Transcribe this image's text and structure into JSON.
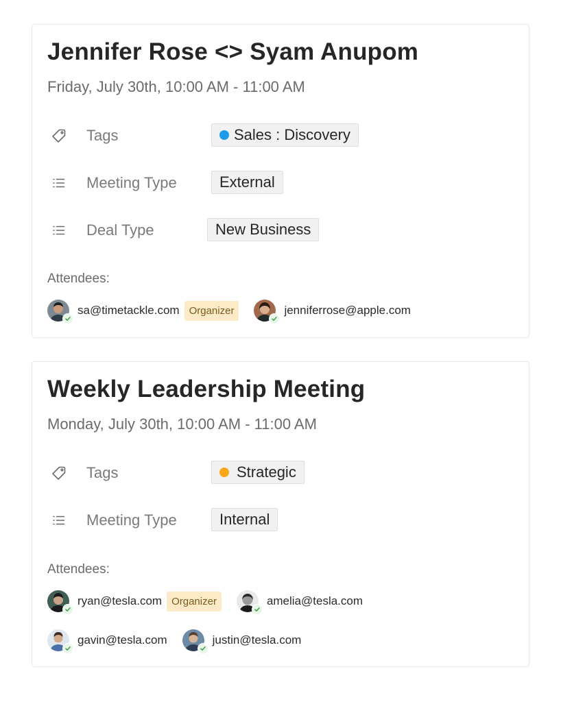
{
  "meetings": [
    {
      "title": "Jennifer Rose <> Syam Anupom",
      "date": "Friday, July 30th, 10:00 AM - 11:00 AM",
      "properties": [
        {
          "icon": "tag-icon",
          "label": "Tags",
          "value": "Sales : Discovery",
          "dot_color": "#1e9be9"
        },
        {
          "icon": "list-icon",
          "label": "Meeting Type",
          "value": "External"
        },
        {
          "icon": "list-icon",
          "label": "Deal Type",
          "value": "New Business"
        }
      ],
      "attendees_label": "Attendees:",
      "attendees": [
        {
          "email": "sa@timetackle.com",
          "role": "Organizer",
          "avatar": "avatar-photo"
        },
        {
          "email": "jenniferrose@apple.com",
          "avatar": "avatar-photo"
        }
      ]
    },
    {
      "title": "Weekly Leadership Meeting",
      "date": "Monday, July 30th, 10:00 AM - 11:00 AM",
      "properties": [
        {
          "icon": "tag-icon",
          "label": "Tags",
          "value": "Strategic",
          "dot_color": "#fba61a"
        },
        {
          "icon": "list-icon",
          "label": "Meeting Type",
          "value": "Internal"
        }
      ],
      "attendees_label": "Attendees:",
      "attendees": [
        {
          "email": "ryan@tesla.com",
          "role": "Organizer",
          "avatar": "avatar-photo"
        },
        {
          "email": "amelia@tesla.com",
          "avatar": "avatar-photo"
        },
        {
          "email": "gavin@tesla.com",
          "avatar": "avatar-photo"
        },
        {
          "email": "justin@tesla.com",
          "avatar": "avatar-photo"
        }
      ]
    }
  ],
  "colors": {
    "organizer_bg": "#fdebc8",
    "check_green": "#43a047",
    "pill_bg": "#f1f1f1"
  }
}
